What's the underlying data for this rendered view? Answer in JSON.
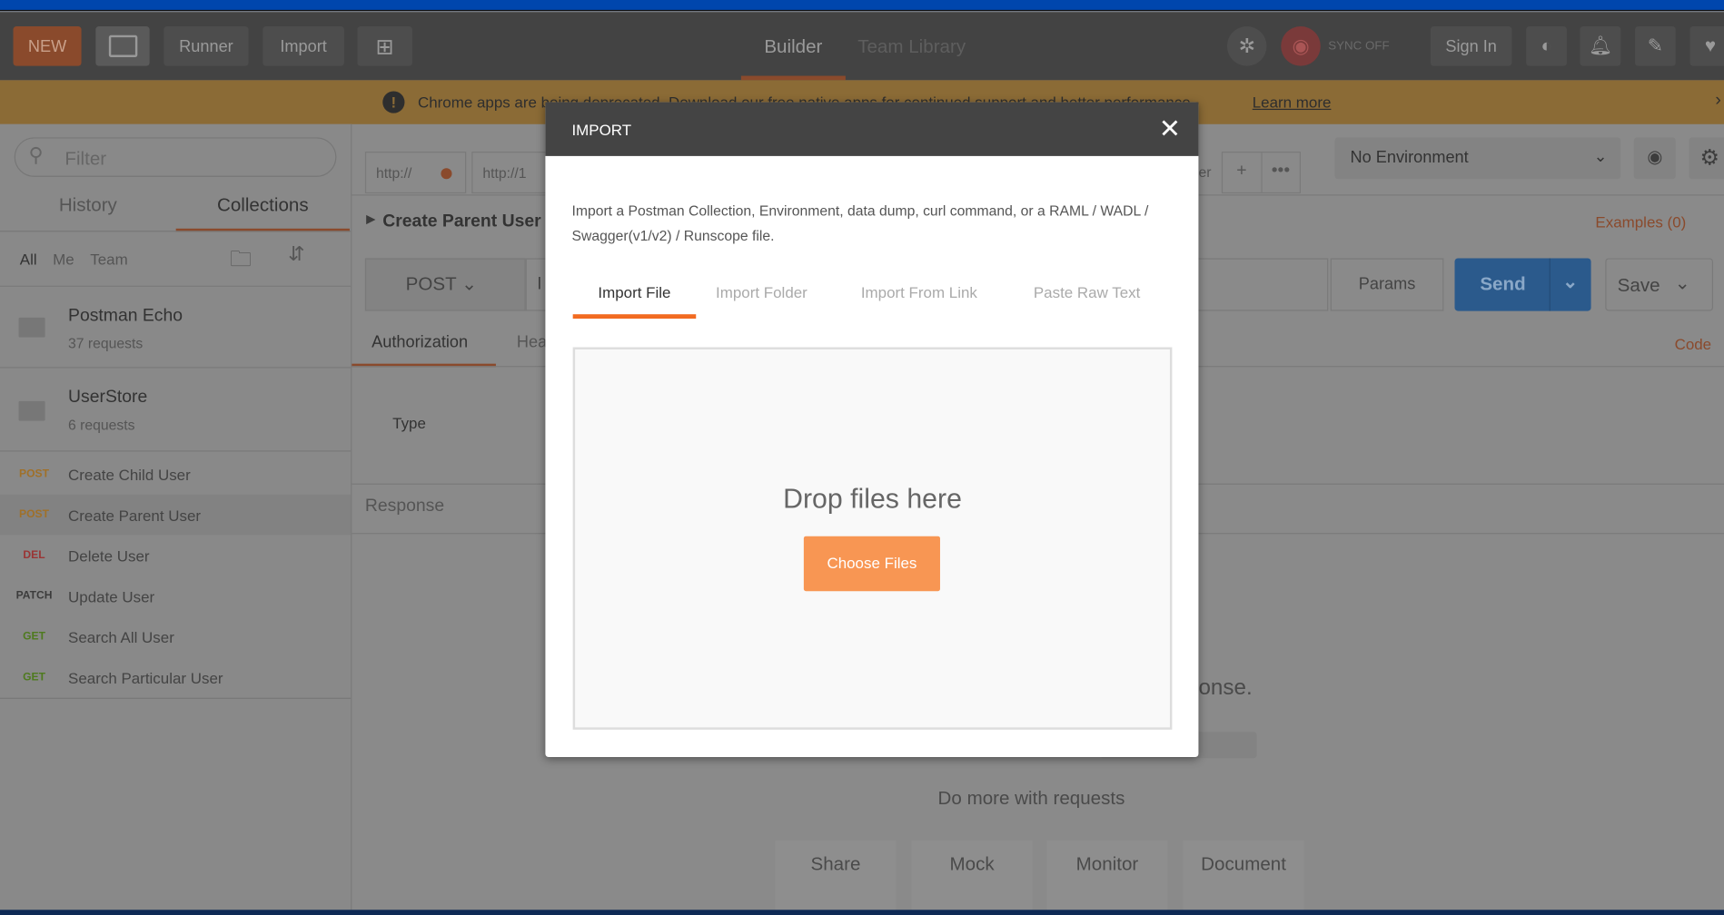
{
  "topbar": {
    "new_label": "NEW",
    "runner_label": "Runner",
    "import_label": "Import",
    "tabs": [
      "Builder",
      "Team Library"
    ],
    "sync_label": "SYNC OFF",
    "signin_label": "Sign In"
  },
  "banner": {
    "text": "Chrome apps are being deprecated. Download our free native apps for continued support and better performance.",
    "link": "Learn more"
  },
  "sidebar": {
    "filter_placeholder": "Filter",
    "tabs": [
      "History",
      "Collections"
    ],
    "filters": [
      "All",
      "Me",
      "Team"
    ],
    "collections": [
      {
        "name": "Postman Echo",
        "count": "37 requests"
      },
      {
        "name": "UserStore",
        "count": "6 requests"
      }
    ],
    "requests": [
      {
        "method": "POST",
        "name": "Create Child User",
        "color": "#a07028"
      },
      {
        "method": "POST",
        "name": "Create Parent User",
        "color": "#a07028"
      },
      {
        "method": "DEL",
        "name": "Delete User",
        "color": "#9a3535"
      },
      {
        "method": "PATCH",
        "name": "Update User",
        "color": "#3c3c3c"
      },
      {
        "method": "GET",
        "name": "Search All User",
        "color": "#4e7a1e"
      },
      {
        "method": "GET",
        "name": "Search Particular User",
        "color": "#4e7a1e"
      }
    ]
  },
  "main": {
    "tab1": "http://",
    "tab2": "http://1",
    "tab_partial": "er",
    "environment": "No Environment",
    "request_title": "Create Parent User",
    "examples": "Examples (0)",
    "method": "POST",
    "url_partial": "l",
    "params": "Params",
    "send": "Send",
    "save": "Save",
    "req_tabs": [
      "Authorization",
      "Hea"
    ],
    "code": "Code",
    "type_label": "Type",
    "response_label": "Response",
    "response_hint": "onse.",
    "more_title": "Do more with requests",
    "cards": [
      "Share",
      "Mock",
      "Monitor",
      "Document"
    ]
  },
  "modal": {
    "title": "IMPORT",
    "description": "Import a Postman Collection, Environment, data dump, curl command, or a RAML / WADL / Swagger(v1/v2) / Runscope file.",
    "tabs": [
      "Import File",
      "Import Folder",
      "Import From Link",
      "Paste Raw Text"
    ],
    "drop_text": "Drop files here",
    "choose_label": "Choose Files"
  },
  "colors": {
    "accent": "#f26b21",
    "send": "#2b5a8c",
    "choose": "#f89653"
  }
}
